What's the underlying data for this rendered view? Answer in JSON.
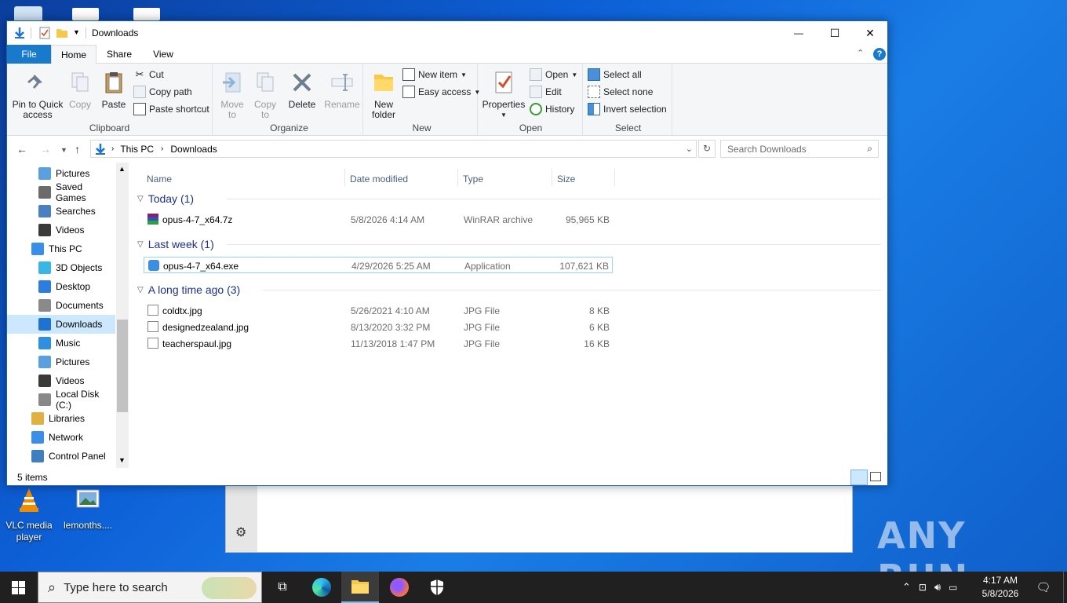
{
  "window": {
    "title": "Downloads",
    "controls": {
      "minimize": "—",
      "maximize": "☐",
      "close": "✕"
    }
  },
  "ribbon_tabs": [
    "File",
    "Home",
    "Share",
    "View"
  ],
  "ribbon": {
    "clipboard": {
      "label": "Clipboard",
      "pin": "Pin to Quick access",
      "copy": "Copy",
      "paste": "Paste",
      "cut": "Cut",
      "copy_path": "Copy path",
      "paste_shortcut": "Paste shortcut"
    },
    "organize": {
      "label": "Organize",
      "move_to": "Move to",
      "copy_to": "Copy to",
      "delete": "Delete",
      "rename": "Rename"
    },
    "new": {
      "label": "New",
      "new_folder": "New folder",
      "new_item": "New item",
      "easy_access": "Easy access"
    },
    "open": {
      "label": "Open",
      "properties": "Properties",
      "open": "Open",
      "edit": "Edit",
      "history": "History"
    },
    "select": {
      "label": "Select",
      "select_all": "Select all",
      "select_none": "Select none",
      "invert": "Invert selection"
    }
  },
  "address": {
    "breadcrumb": [
      "This PC",
      "Downloads"
    ],
    "search_placeholder": "Search Downloads"
  },
  "nav": [
    {
      "label": "Pictures",
      "icon": "pictures-icon",
      "indent": 1
    },
    {
      "label": "Saved Games",
      "icon": "saved-games-icon",
      "indent": 1
    },
    {
      "label": "Searches",
      "icon": "searches-icon",
      "indent": 1
    },
    {
      "label": "Videos",
      "icon": "videos-icon",
      "indent": 1
    },
    {
      "label": "This PC",
      "icon": "this-pc-icon",
      "indent": 0
    },
    {
      "label": "3D Objects",
      "icon": "3d-objects-icon",
      "indent": 1
    },
    {
      "label": "Desktop",
      "icon": "desktop-icon",
      "indent": 1
    },
    {
      "label": "Documents",
      "icon": "documents-icon",
      "indent": 1
    },
    {
      "label": "Downloads",
      "icon": "downloads-icon",
      "indent": 1,
      "selected": true
    },
    {
      "label": "Music",
      "icon": "music-icon",
      "indent": 1
    },
    {
      "label": "Pictures",
      "icon": "pictures-icon",
      "indent": 1
    },
    {
      "label": "Videos",
      "icon": "videos-icon",
      "indent": 1
    },
    {
      "label": "Local Disk (C:)",
      "icon": "local-disk-icon",
      "indent": 1
    },
    {
      "label": "Libraries",
      "icon": "libraries-icon",
      "indent": 0
    },
    {
      "label": "Network",
      "icon": "network-icon",
      "indent": 0
    },
    {
      "label": "Control Panel",
      "icon": "control-panel-icon",
      "indent": 0
    }
  ],
  "columns": [
    "Name",
    "Date modified",
    "Type",
    "Size"
  ],
  "groups": [
    {
      "label": "Today (1)",
      "files": [
        {
          "name": "opus-4-7_x64.7z",
          "date": "5/8/2026 4:14 AM",
          "type": "WinRAR archive",
          "size": "95,965 KB",
          "icon": "winrar-archive-icon"
        }
      ]
    },
    {
      "label": "Last week (1)",
      "files": [
        {
          "name": "opus-4-7_x64.exe",
          "date": "4/29/2026 5:25 AM",
          "type": "Application",
          "size": "107,621 KB",
          "icon": "application-icon",
          "selected": true
        }
      ]
    },
    {
      "label": "A long time ago (3)",
      "files": [
        {
          "name": "coldtx.jpg",
          "date": "5/26/2021 4:10 AM",
          "type": "JPG File",
          "size": "8 KB",
          "icon": "jpg-file-icon"
        },
        {
          "name": "designedzealand.jpg",
          "date": "8/13/2020 3:32 PM",
          "type": "JPG File",
          "size": "6 KB",
          "icon": "jpg-file-icon"
        },
        {
          "name": "teacherspaul.jpg",
          "date": "11/13/2018 1:47 PM",
          "type": "JPG File",
          "size": "16 KB",
          "icon": "jpg-file-icon"
        }
      ]
    }
  ],
  "status": {
    "items": "5 items"
  },
  "desktop": {
    "vlc": "VLC media player",
    "lemonths": "lemonths....",
    "watermark": "ANY RUN"
  },
  "taskbar": {
    "search_placeholder": "Type here to search",
    "time": "4:17 AM",
    "date": "5/8/2026"
  }
}
